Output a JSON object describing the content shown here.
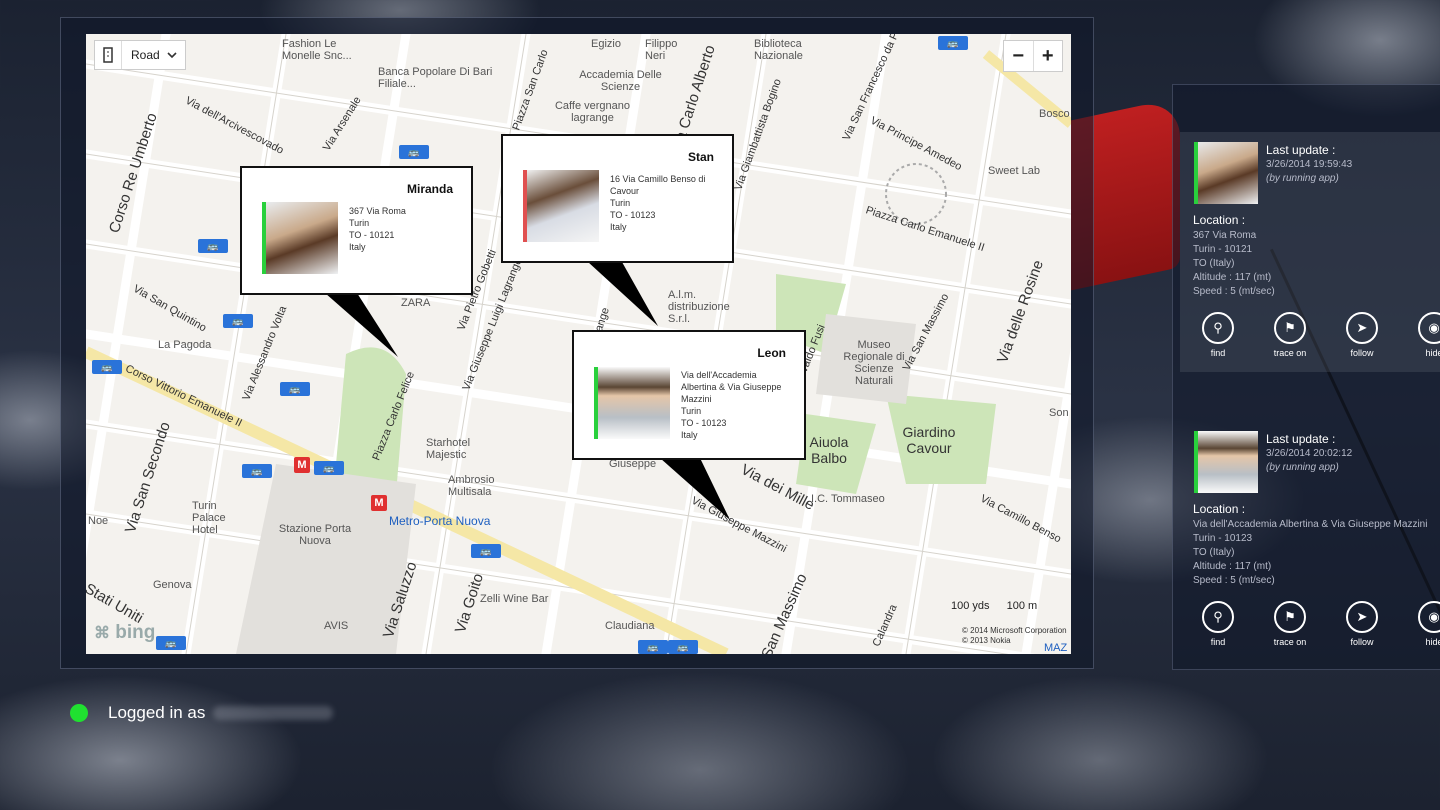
{
  "map": {
    "view_mode": "Road",
    "zoom_out": "−",
    "zoom_in": "+",
    "scale_yds": "100 yds",
    "scale_m": "100 m",
    "copyright": [
      "© 2014 Microsoft Corporation",
      "© 2013 Nokia"
    ],
    "provider": "bing",
    "places": [
      "Fashion Le Monelle Snc...",
      "Egizio",
      "Filippo Neri",
      "Biblioteca Nazionale",
      "Banca Popolare Di Bari Filiale...",
      "Accademia Delle Scienze",
      "Caffe vergnano lagrange",
      "Sweet Lab",
      "Bosco",
      "ZARA",
      "La Pagoda",
      "A.l.m. distribuzione S.r.l.",
      "Museo Regionale di Scienze Naturali",
      "Giardino Cavour",
      "Aiuola Balbo",
      "Starhotel Majestic",
      "Ambrosio Multisala",
      "Turin Palace Hotel",
      "Stazione Porta Nuova",
      "Genova",
      "Zelli Wine Bar",
      "AVIS",
      "Claudiana",
      "I.C. Tommaseo",
      "Metro-Porta Nuova",
      "Noe",
      "Giuseppe",
      "Son",
      "MAZ"
    ],
    "streets": [
      "Corso Re Umberto",
      "Via Arsenale",
      "Via dell'Arcivescovado",
      "Piazza San Carlo",
      "Via Carlo Alberto",
      "Via Giambattista Bogino",
      "Via San Francesco da Paola",
      "Via Principe Amedeo",
      "Piazza Carlo Emanuele II",
      "Via San Quintino",
      "Via Alessandro Volta",
      "Via Pietro Gobetti",
      "Via Giuseppe Luigi Lagrange",
      "Piazza Carlo Felice",
      "Corso Vittorio Emanuele II",
      "Via San Secondo",
      "Via Valdo Fusi",
      "Via San Massimo",
      "Via delle Rosine",
      "Via Giuseppe Mazzini",
      "Via dei Mille",
      "Via Camillo Benso",
      "Via Saluzzo",
      "Via Goito",
      "Stati Uniti",
      "San Massimo",
      "Calandra",
      "Via Lagrange"
    ]
  },
  "bubbles": [
    {
      "name": "Miranda",
      "address": [
        "367 Via Roma",
        "Turin",
        "TO - 10121",
        "Italy"
      ],
      "bar_color": "#29d03c"
    },
    {
      "name": "Stan",
      "address": [
        "16 Via Camillo Benso di",
        "Cavour",
        "Turin",
        "TO - 10123",
        "Italy"
      ],
      "bar_color": "#e05050"
    },
    {
      "name": "Leon",
      "address": [
        "Via dell'Accademia",
        "Albertina & Via Giuseppe",
        "Mazzini",
        "Turin",
        "TO - 10123",
        "Italy"
      ],
      "bar_color": "#29d03c"
    }
  ],
  "cards": [
    {
      "last_update_label": "Last update :",
      "timestamp": "3/26/2014 19:59:43",
      "source": "(by running app)",
      "location_label": "Location :",
      "location": [
        "367 Via Roma",
        "Turin - 10121",
        "TO (Italy)",
        "Altitude : 117 (mt)",
        "Speed : 5 (mt/sec)"
      ],
      "actions": [
        "find",
        "trace on",
        "follow",
        "hide"
      ]
    },
    {
      "last_update_label": "Last update :",
      "timestamp": "3/26/2014 20:02:12",
      "source": "(by running app)",
      "location_label": "Location :",
      "location": [
        "Via dell'Accademia Albertina & Via Giuseppe Mazzini",
        "Turin - 10123",
        "TO (Italy)",
        "Altitude : 117 (mt)",
        "Speed : 5 (mt/sec)"
      ],
      "actions": [
        "find",
        "trace on",
        "follow",
        "hide"
      ]
    }
  ],
  "status": {
    "text": "Logged in as",
    "indicator_color": "#20e030"
  },
  "icons": {
    "view": "map-view-icon",
    "dropdown": "chevron-down-icon",
    "find": "search-icon",
    "trace": "trace-icon",
    "follow": "runner-icon",
    "hide": "hide-icon"
  }
}
